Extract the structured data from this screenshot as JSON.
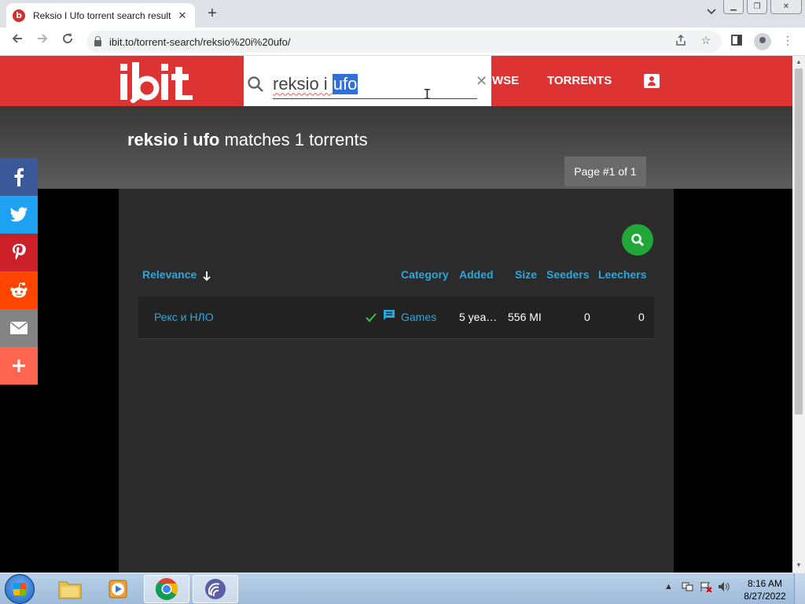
{
  "browser": {
    "tab_title": "Reksio I Ufo torrent search result",
    "favicon_letter": "b",
    "url": "ibit.to/torrent-search/reksio%20i%20ufo/"
  },
  "site": {
    "logo_text": "ibit",
    "search": {
      "value_plain": "reksio i ",
      "value_selected": "ufo"
    },
    "nav": {
      "browse_partial": "WSE",
      "torrents": "TORRENTS"
    },
    "heading_query": "reksio i ufo",
    "heading_suffix": " matches 1 torrents",
    "page_badge": "Page #1 of 1",
    "columns": {
      "relevance": "Relevance",
      "category": "Category",
      "added": "Added",
      "size": "Size",
      "seeders": "Seeders",
      "leechers": "Leechers"
    },
    "results": [
      {
        "name": "Рекс и НЛО",
        "category": "Games",
        "added": "5 yea…",
        "size": "556 MI",
        "seeders": "0",
        "leechers": "0"
      }
    ]
  },
  "share": [
    {
      "name": "facebook",
      "color": "#3b5998"
    },
    {
      "name": "twitter",
      "color": "#1da1f2"
    },
    {
      "name": "pinterest",
      "color": "#cb2027"
    },
    {
      "name": "reddit",
      "color": "#ff4500"
    },
    {
      "name": "email",
      "color": "#848484"
    },
    {
      "name": "more",
      "color": "#ff6550"
    }
  ],
  "taskbar": {
    "time": "8:16 AM",
    "date": "8/27/2022"
  },
  "colors": {
    "brand_red": "#dd3333",
    "link_blue": "#29a8e0",
    "green": "#21a638"
  }
}
